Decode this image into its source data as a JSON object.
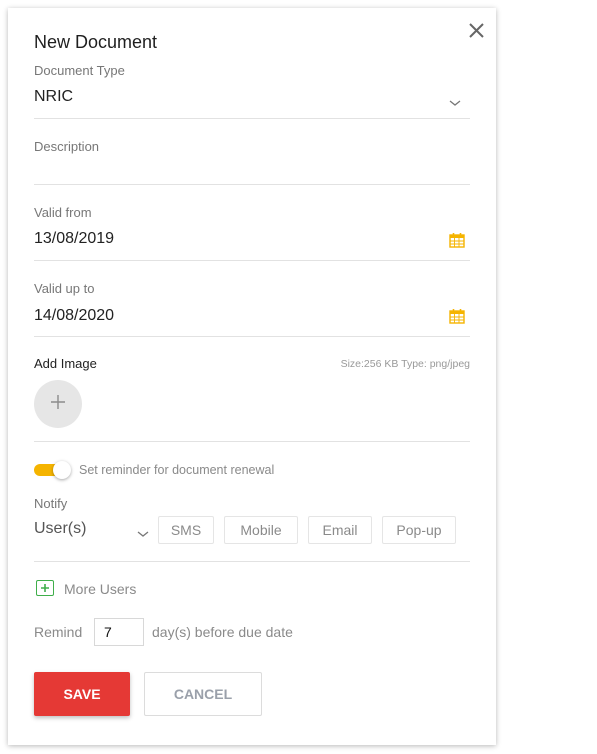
{
  "dialog": {
    "title": "New Document",
    "close_icon": "close-icon"
  },
  "fields": {
    "document_type": {
      "label": "Document Type",
      "value": "NRIC",
      "icon": "chevron-down-icon"
    },
    "description": {
      "label": "Description",
      "value": ""
    },
    "valid_from": {
      "label": "Valid from",
      "value": "13/08/2019",
      "icon": "calendar-icon"
    },
    "valid_up_to": {
      "label": "Valid up to",
      "value": "14/08/2020",
      "icon": "calendar-icon"
    }
  },
  "image": {
    "label": "Add Image",
    "hint": "Size:256 KB Type: png/jpeg",
    "add_icon": "plus-icon"
  },
  "reminder": {
    "toggle_on": true,
    "label": "Set reminder for document renewal"
  },
  "notify": {
    "label": "Notify",
    "selected": "User(s)",
    "channels": [
      "SMS",
      "Mobile",
      "Email",
      "Pop-up"
    ]
  },
  "more_users": {
    "label": "More Users",
    "icon": "plus-square-icon"
  },
  "remind": {
    "prefix": "Remind",
    "days": "7",
    "suffix": "day(s) before due date"
  },
  "actions": {
    "save_label": "SAVE",
    "cancel_label": "CANCEL"
  },
  "colors": {
    "accent_yellow": "#f5b400",
    "save_red": "#e53935",
    "add_green": "#3fae4a"
  }
}
